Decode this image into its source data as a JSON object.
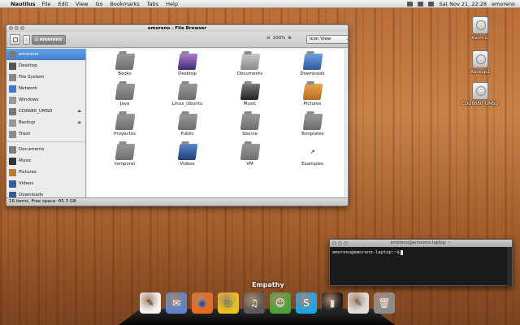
{
  "menubar": {
    "app_name": "Nautilus",
    "menus": [
      "File",
      "Edit",
      "View",
      "Go",
      "Bookmarks",
      "Tabs",
      "Help"
    ],
    "datetime": "Sat Nov 21, 22:28",
    "user": "emoreno"
  },
  "file_browser": {
    "title": "emoreno - File Browser",
    "breadcrumb": "emoreno",
    "zoom": "100%",
    "view_mode": "Icon View",
    "sidebar": [
      {
        "label": "emoreno",
        "icon": "home-icon",
        "active": true,
        "color": "#7a7a7a"
      },
      {
        "label": "Desktop",
        "icon": "desktop-icon",
        "color": "#555555"
      },
      {
        "label": "File System",
        "icon": "harddrive-icon",
        "color": "#888888"
      },
      {
        "label": "Network",
        "icon": "network-icon",
        "color": "#3a7bd5"
      },
      {
        "label": "Windows",
        "icon": "drive-icon",
        "color": "#999999"
      },
      {
        "label": "CD6680_UMSD",
        "icon": "usb-icon",
        "eject": true,
        "color": "#777777"
      },
      {
        "label": "Backup",
        "icon": "drive-icon",
        "eject": true,
        "color": "#999999"
      },
      {
        "label": "Trash",
        "icon": "trash-icon",
        "color": "#8c8c8c"
      },
      {
        "label": "Documents",
        "icon": "folder-icon",
        "color": "#7d7d7d"
      },
      {
        "label": "Music",
        "icon": "music-folder-icon",
        "color": "#333333"
      },
      {
        "label": "Pictures",
        "icon": "pictures-folder-icon",
        "color": "#c07a2a"
      },
      {
        "label": "Videos",
        "icon": "videos-folder-icon",
        "color": "#2f5fa0"
      },
      {
        "label": "Downloads",
        "icon": "downloads-folder-icon",
        "color": "#2f5fa0"
      }
    ],
    "items": [
      {
        "label": "Books",
        "icon": "folder-icon"
      },
      {
        "label": "Desktop",
        "icon": "desktop-folder-icon"
      },
      {
        "label": "Documents",
        "icon": "documents-folder-icon"
      },
      {
        "label": "Downloads",
        "icon": "downloads-folder-icon"
      },
      {
        "label": "Java",
        "icon": "folder-icon"
      },
      {
        "label": "Linux_Ubuntu",
        "icon": "folder-icon"
      },
      {
        "label": "Music",
        "icon": "music-folder-icon"
      },
      {
        "label": "Pictures",
        "icon": "pictures-folder-icon"
      },
      {
        "label": "Proyectos",
        "icon": "folder-icon"
      },
      {
        "label": "Public",
        "icon": "folder-icon"
      },
      {
        "label": "Source",
        "icon": "folder-icon"
      },
      {
        "label": "Templates",
        "icon": "folder-icon"
      },
      {
        "label": "temporal",
        "icon": "folder-icon"
      },
      {
        "label": "Videos",
        "icon": "videos-folder-icon"
      },
      {
        "label": "VM",
        "icon": "folder-icon"
      },
      {
        "label": "Examples",
        "icon": "link-icon"
      }
    ],
    "status": "16 items, Free space: 85.3 GB"
  },
  "desktop_icons": [
    {
      "label": "Kavmic",
      "icon": "harddrive-icon"
    },
    {
      "label": "Backup2",
      "icon": "harddrive-icon"
    },
    {
      "label": "CDU6680_UMSD",
      "icon": "usb-drive-icon"
    }
  ],
  "terminal": {
    "title": "emoreno@emoreno-laptop: ~",
    "prompt": "emoreno@emoreno-laptop:~$"
  },
  "dock": {
    "hover_label": "Empathy",
    "apps": [
      {
        "name": "inkscape-icon",
        "color": "#f2f2f2",
        "glyph": "✎",
        "glyph_color": "#333333"
      },
      {
        "name": "mail-icon",
        "color": "#5d86c8",
        "glyph": "✉",
        "glyph_color": "#ffffff"
      },
      {
        "name": "firefox-icon",
        "color": "#e66c1f",
        "glyph": "◉",
        "glyph_color": "#2a4fa0"
      },
      {
        "name": "chrome-icon",
        "color": "#e8c21e",
        "glyph": "◎",
        "glyph_color": "#2e8b3c"
      },
      {
        "name": "music-player-icon",
        "color": "#5a5a5a",
        "glyph": "♫",
        "glyph_color": "#ffffff"
      },
      {
        "name": "empathy-icon",
        "color": "#4ca23a",
        "glyph": "☺",
        "glyph_color": "#ffffff"
      },
      {
        "name": "skype-icon",
        "color": "#1ea4e2",
        "glyph": "S",
        "glyph_color": "#ffffff"
      },
      {
        "name": "terminal-icon",
        "color": "#222222",
        "glyph": "▮",
        "glyph_color": "#dddddd"
      },
      {
        "name": "text-editor-icon",
        "color": "#dcdcdc",
        "glyph": "✎",
        "glyph_color": "#555555"
      },
      {
        "name": "trash-icon",
        "color": "#8c8c8c",
        "glyph": "🗑",
        "glyph_color": "#f0f0f0"
      }
    ]
  }
}
